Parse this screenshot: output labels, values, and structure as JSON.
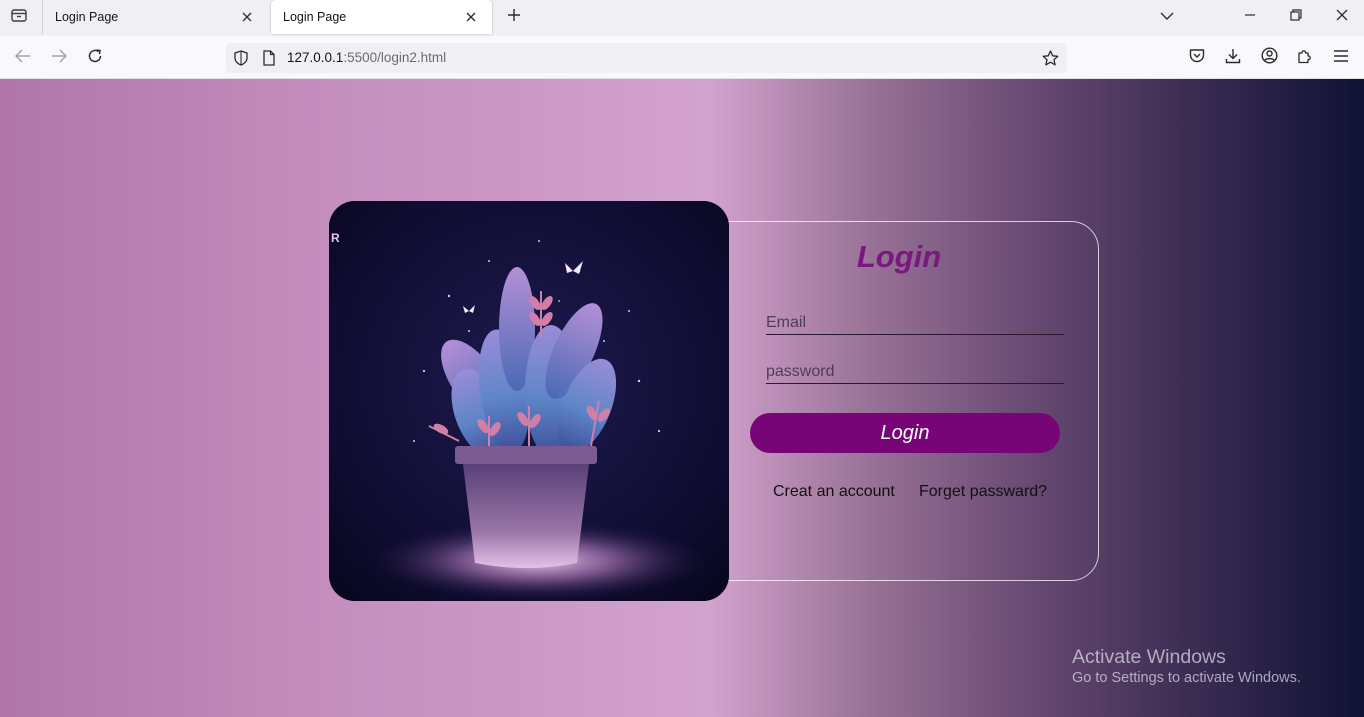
{
  "browser": {
    "tabs": [
      {
        "title": "Login Page",
        "active": false
      },
      {
        "title": "Login Page",
        "active": true
      }
    ],
    "url_host": "127.0.0.1",
    "url_rest": ":5500/login2.html"
  },
  "login": {
    "title": "Login",
    "email_placeholder": "Email",
    "password_placeholder": "password",
    "button_label": "Login",
    "create_account_label": "Creat an account",
    "forgot_password_label": "Forget passward?"
  },
  "image_card": {
    "corner_text": "R"
  },
  "watermark": {
    "title": "Activate Windows",
    "subtitle": "Go to Settings to activate Windows."
  },
  "colors": {
    "accent": "#780578",
    "title": "#7a1780",
    "gradient_left": "#b076a8",
    "gradient_right": "#0f1234"
  }
}
